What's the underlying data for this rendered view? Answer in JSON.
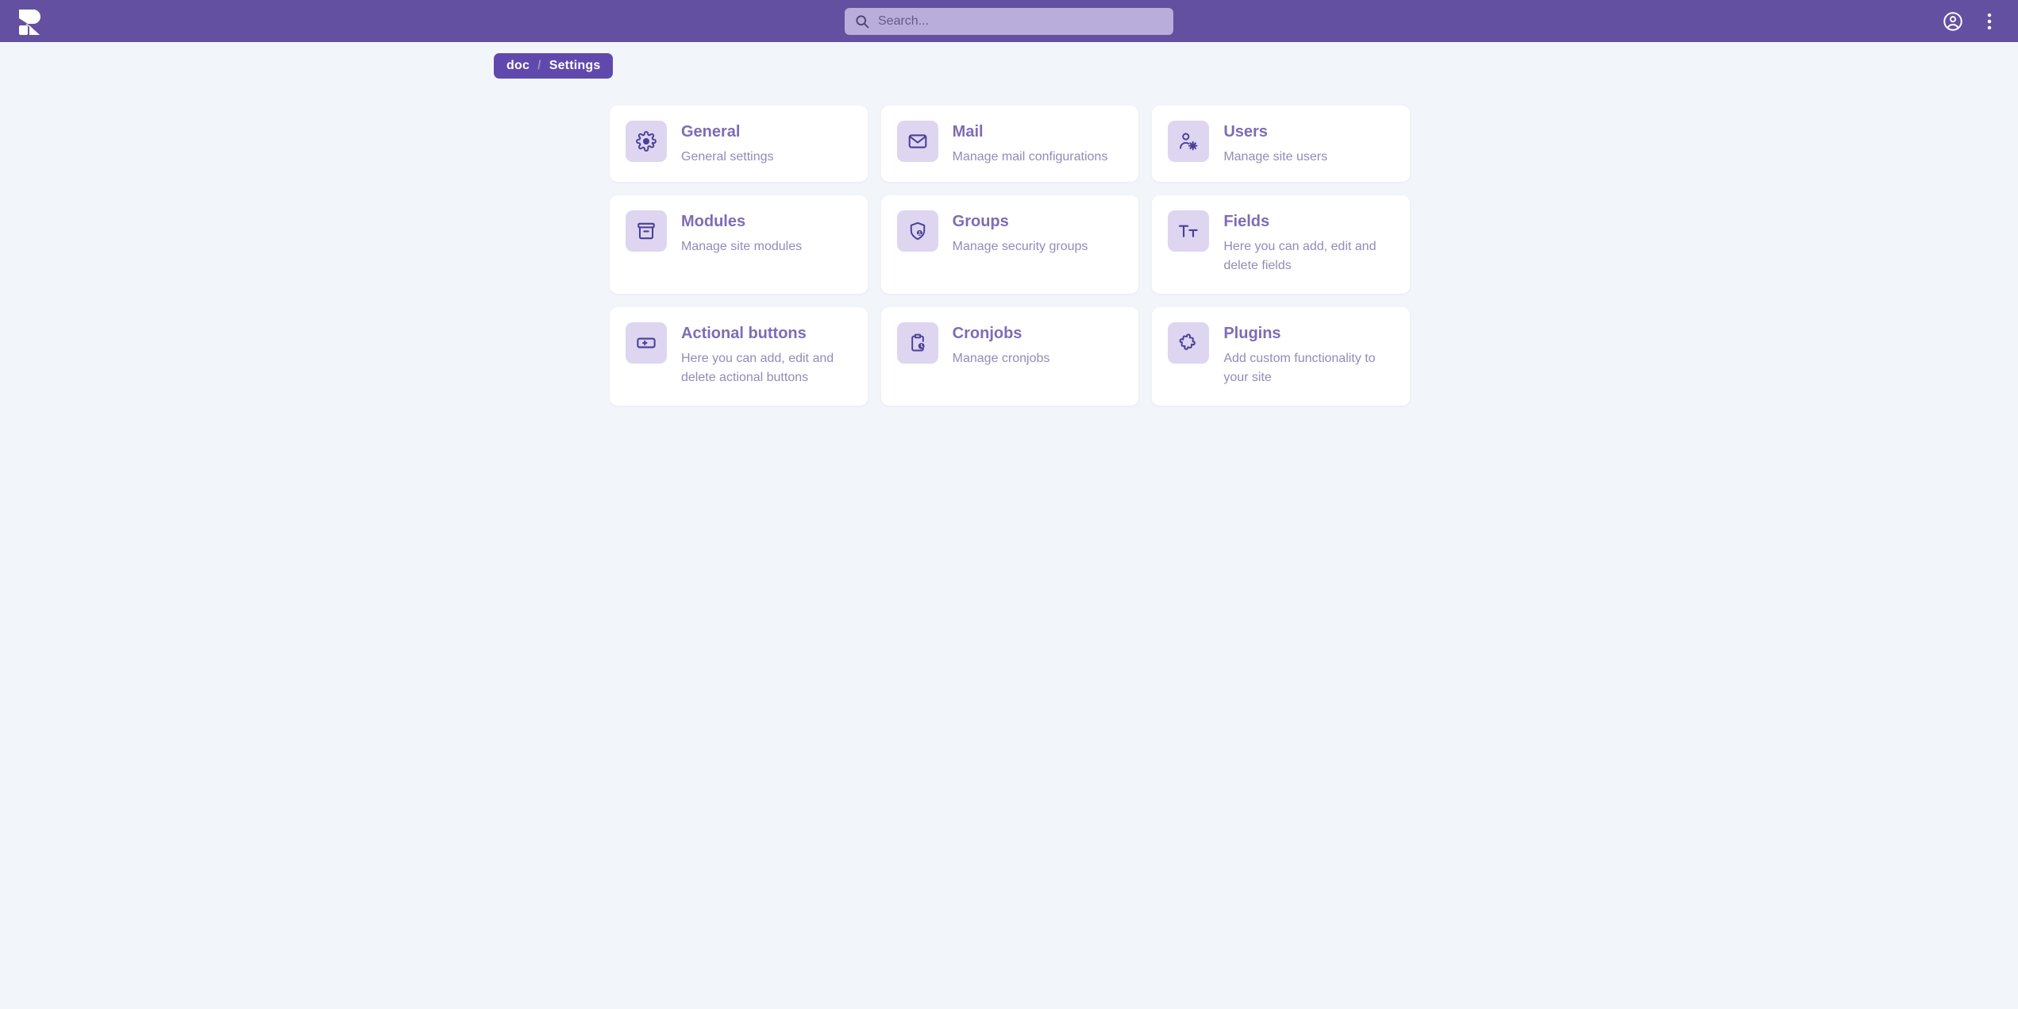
{
  "colors": {
    "header_purple": "#6450a0",
    "breadcrumb_purple": "#6049ad",
    "page_background": "#f2f6fa",
    "card_background": "#ffffff",
    "icon_tile": "#ded5f0",
    "icon_stroke": "#4b3f99",
    "title_purple": "#7e6cb5",
    "subtitle_gray": "#938bb8",
    "search_field": "#b9addb"
  },
  "header": {
    "logo_name": "app-logo",
    "search": {
      "placeholder": "Search...",
      "value": "",
      "icon": "search-icon"
    },
    "actions": [
      {
        "name": "account-circle-icon",
        "label": "Account"
      },
      {
        "name": "more-vertical-icon",
        "label": "More options"
      }
    ]
  },
  "breadcrumb": {
    "items": [
      {
        "label": "doc"
      },
      {
        "label": "Settings"
      }
    ],
    "separator": "/"
  },
  "cards": [
    {
      "title": "General",
      "subtitle": "General settings",
      "icon": "gear-icon",
      "tall": false
    },
    {
      "title": "Mail",
      "subtitle": "Manage mail configurations",
      "icon": "envelope-icon",
      "tall": false
    },
    {
      "title": "Users",
      "subtitle": "Manage site users",
      "icon": "user-cog-icon",
      "tall": false
    },
    {
      "title": "Modules",
      "subtitle": "Manage site modules",
      "icon": "archive-box-icon",
      "tall": true
    },
    {
      "title": "Groups",
      "subtitle": "Manage security groups",
      "icon": "shield-user-icon",
      "tall": true
    },
    {
      "title": "Fields",
      "subtitle": "Here you can add, edit and delete fields",
      "icon": "text-format-icon",
      "tall": true
    },
    {
      "title": "Actional buttons",
      "subtitle": "Here you can add, edit and delete actional buttons",
      "icon": "button-plus-icon",
      "tall": true
    },
    {
      "title": "Cronjobs",
      "subtitle": "Manage cronjobs",
      "icon": "clipboard-clock-icon",
      "tall": true
    },
    {
      "title": "Plugins",
      "subtitle": "Add custom functionality to your site",
      "icon": "puzzle-piece-icon",
      "tall": true
    }
  ]
}
